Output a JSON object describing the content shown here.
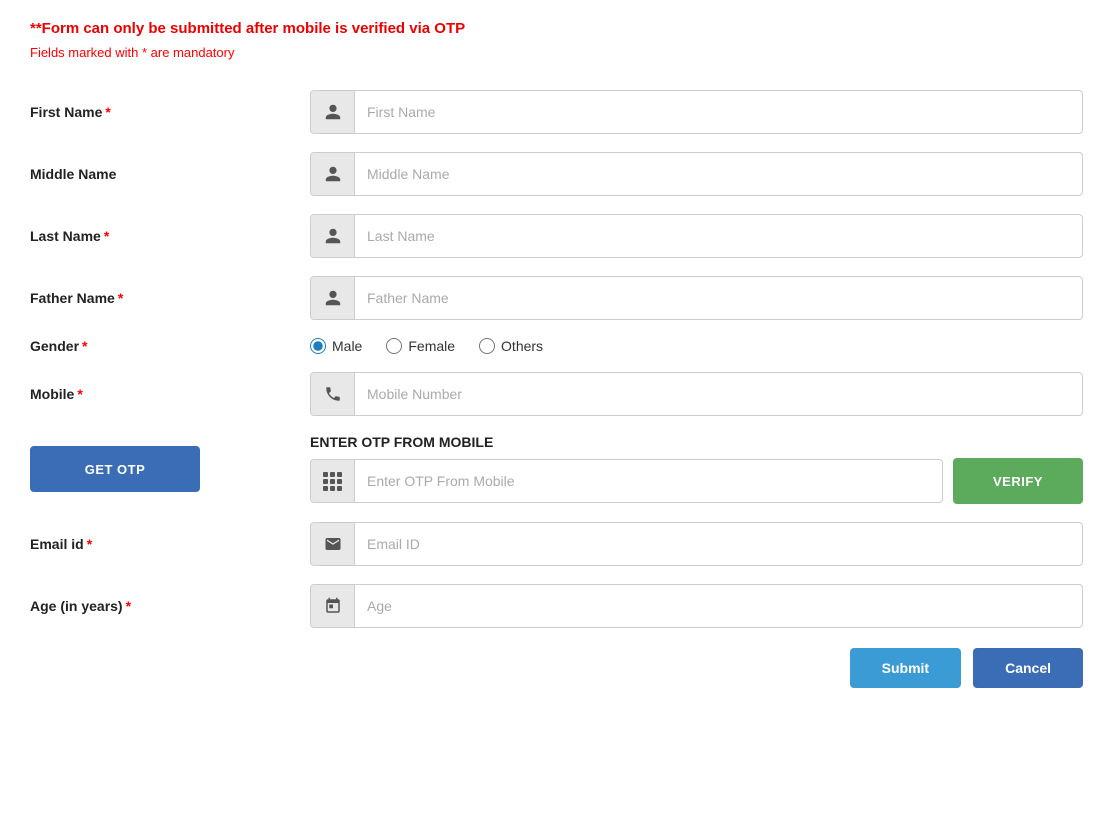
{
  "warnings": {
    "otp_warning": "**Form can only be submitted after mobile is verified via OTP",
    "mandatory_note_prefix": "Fields marked with ",
    "mandatory_star": "*",
    "mandatory_note_suffix": " are mandatory"
  },
  "form": {
    "first_name": {
      "label": "First Name",
      "required": true,
      "placeholder": "First Name"
    },
    "middle_name": {
      "label": "Middle Name",
      "required": false,
      "placeholder": "Middle Name"
    },
    "last_name": {
      "label": "Last Name",
      "required": true,
      "placeholder": "Last Name"
    },
    "father_name": {
      "label": "Father Name",
      "required": true,
      "placeholder": "Father Name"
    },
    "gender": {
      "label": "Gender",
      "required": true,
      "options": [
        "Male",
        "Female",
        "Others"
      ],
      "selected": "Male"
    },
    "mobile": {
      "label": "Mobile",
      "required": true,
      "placeholder": "Mobile Number"
    },
    "otp": {
      "section_label": "ENTER OTP FROM MOBILE",
      "placeholder": "Enter OTP From Mobile",
      "get_otp_label": "GET OTP",
      "verify_label": "VERIFY"
    },
    "email": {
      "label": "Email id",
      "required": true,
      "placeholder": "Email ID"
    },
    "age": {
      "label": "Age (in years)",
      "required": true,
      "placeholder": "Age"
    }
  },
  "buttons": {
    "submit": "Submit",
    "cancel": "Cancel"
  }
}
